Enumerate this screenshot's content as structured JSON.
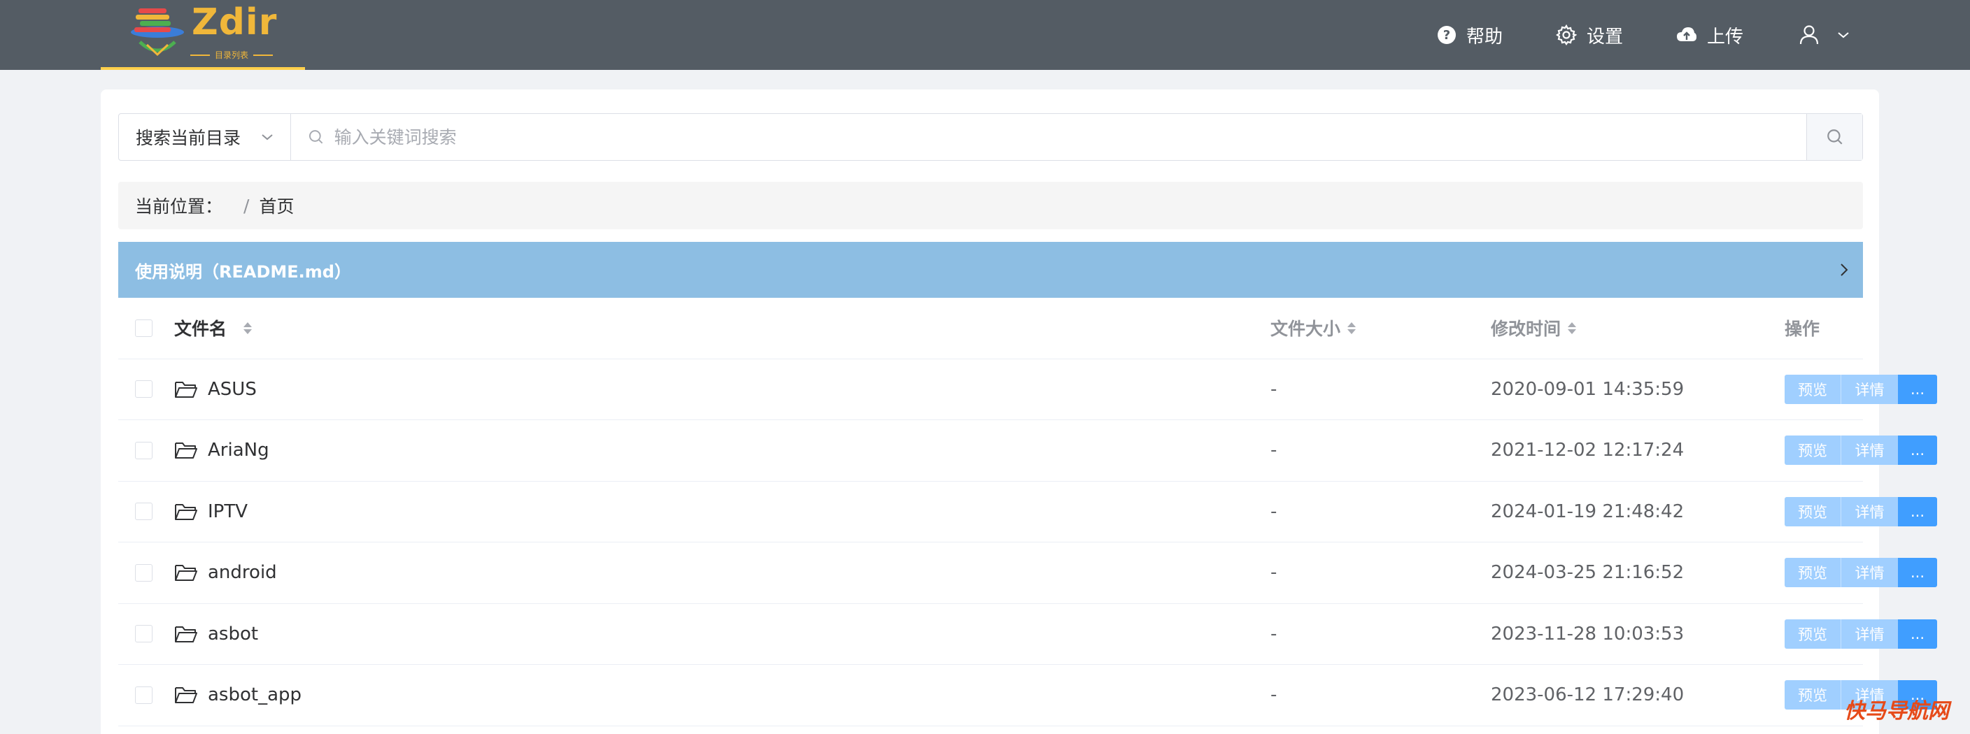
{
  "app": {
    "logo_text": "Zdir",
    "logo_subtitle": "目录列表"
  },
  "nav": {
    "help_label": "帮助",
    "settings_label": "设置",
    "upload_label": "上传"
  },
  "search": {
    "scope_value": "搜索当前目录",
    "placeholder": "输入关键词搜索"
  },
  "breadcrumb": {
    "label": "当前位置：",
    "separator": "/",
    "current": "首页"
  },
  "readme": {
    "title": "使用说明（README.md）"
  },
  "table": {
    "columns": {
      "name": "文件名",
      "size": "文件大小",
      "mtime": "修改时间",
      "actions": "操作"
    },
    "rows": [
      {
        "name": "ASUS",
        "size": "-",
        "mtime": "2020-09-01 14:35:59"
      },
      {
        "name": "AriaNg",
        "size": "-",
        "mtime": "2021-12-02 12:17:24"
      },
      {
        "name": "IPTV",
        "size": "-",
        "mtime": "2024-01-19 21:48:42"
      },
      {
        "name": "android",
        "size": "-",
        "mtime": "2024-03-25 21:16:52"
      },
      {
        "name": "asbot",
        "size": "-",
        "mtime": "2023-11-28 10:03:53"
      },
      {
        "name": "asbot_app",
        "size": "-",
        "mtime": "2023-06-12 17:29:40"
      }
    ],
    "actions": {
      "preview": "预览",
      "detail": "详情",
      "more": "..."
    }
  },
  "watermark": "快马导航网",
  "colors": {
    "topbar": "#545c64",
    "accent": "#409eff",
    "readme_bg": "#8dbee3",
    "logo": "#f0b73a"
  }
}
